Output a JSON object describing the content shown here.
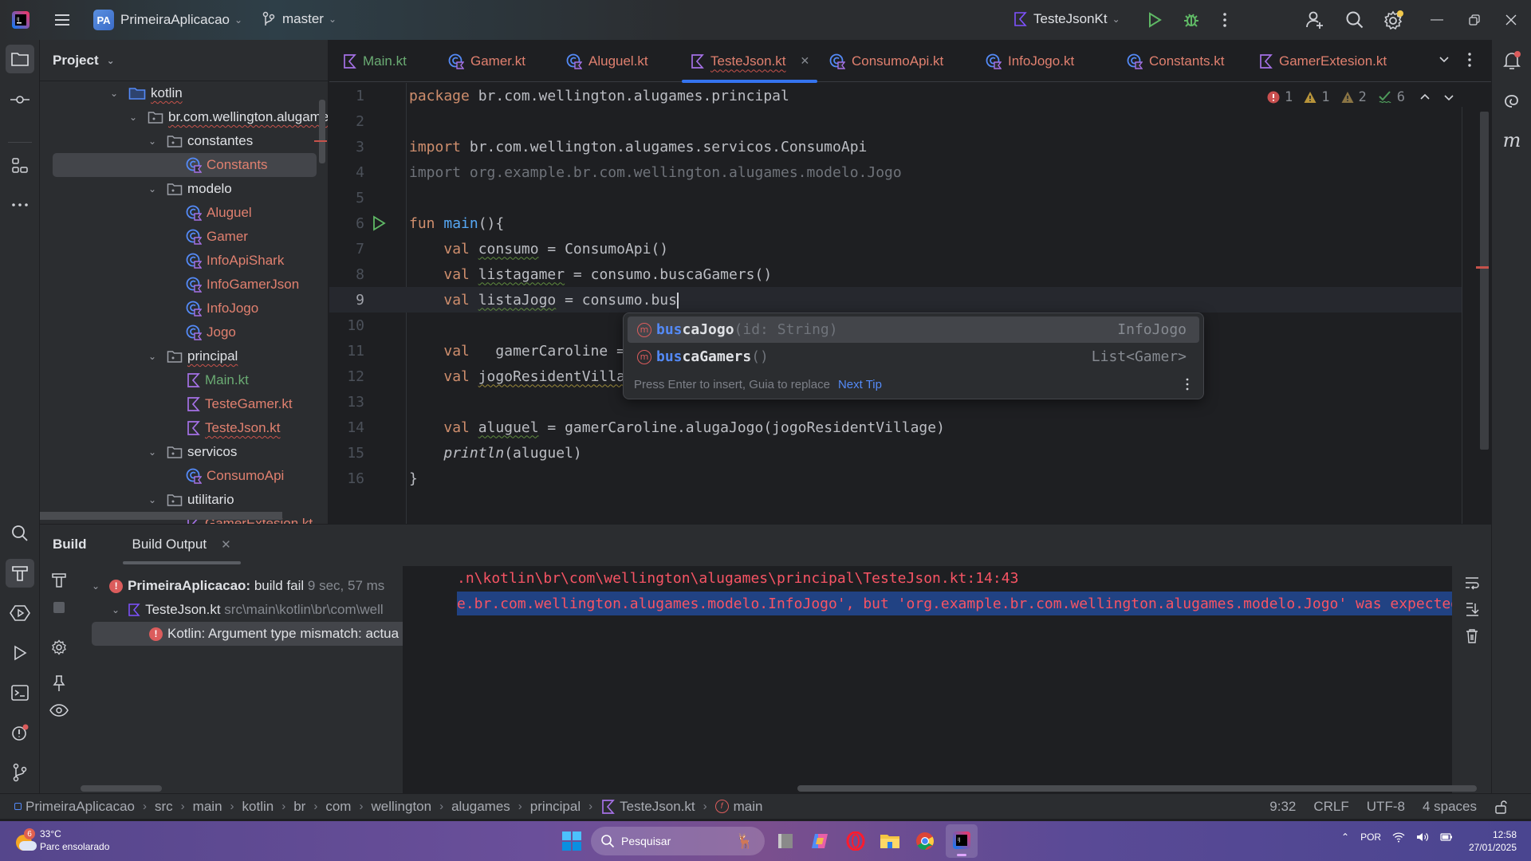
{
  "titlebar": {
    "project_badge": "PA",
    "project_name": "PrimeiraAplicacao",
    "branch": "master",
    "run_config": "TesteJsonKt",
    "icons": [
      "intellij-logo-icon",
      "main-menu-icon",
      "branch-icon",
      "kotlin-file-icon",
      "run-icon",
      "debug-icon",
      "more-vert-icon",
      "add-user-icon",
      "search-icon",
      "settings-icon",
      "minimize-icon",
      "restore-icon",
      "close-icon"
    ]
  },
  "left_strip": {
    "icons": [
      "project-folder-icon",
      "commit-icon",
      "structure-icon",
      "more-tools-icon",
      "find-icon",
      "build-hammer-icon",
      "services-icon",
      "run-icon",
      "terminal-icon",
      "problems-icon",
      "git-icon"
    ]
  },
  "right_strip": {
    "icons": [
      "notifications-icon",
      "ai-assistant-icon",
      "maven-icon"
    ]
  },
  "project_panel": {
    "title": "Project",
    "tree": [
      {
        "label": "kotlin",
        "type": "source-folder",
        "depth": 0,
        "expanded": true,
        "error": true
      },
      {
        "label": "br.com.wellington.alugames",
        "type": "package",
        "depth": 1,
        "expanded": true,
        "error": true
      },
      {
        "label": "constantes",
        "type": "package",
        "depth": 2,
        "expanded": true
      },
      {
        "label": "Constants",
        "type": "class",
        "depth": 3,
        "selected": true,
        "error": true
      },
      {
        "label": "modelo",
        "type": "package",
        "depth": 2,
        "expanded": true
      },
      {
        "label": "Aluguel",
        "type": "class",
        "depth": 3,
        "error": true
      },
      {
        "label": "Gamer",
        "type": "class",
        "depth": 3,
        "error": true
      },
      {
        "label": "InfoApiShark",
        "type": "class",
        "depth": 3,
        "error": true
      },
      {
        "label": "InfoGamerJson",
        "type": "class",
        "depth": 3,
        "error": true
      },
      {
        "label": "InfoJogo",
        "type": "class",
        "depth": 3,
        "error": true
      },
      {
        "label": "Jogo",
        "type": "class",
        "depth": 3,
        "error": true
      },
      {
        "label": "principal",
        "type": "package",
        "depth": 2,
        "expanded": true,
        "error": true
      },
      {
        "label": "Main.kt",
        "type": "kotlin-file",
        "depth": 3,
        "ok": true
      },
      {
        "label": "TesteGamer.kt",
        "type": "kotlin-file",
        "depth": 3,
        "error": true
      },
      {
        "label": "TesteJson.kt",
        "type": "kotlin-file",
        "depth": 3,
        "error": true
      },
      {
        "label": "servicos",
        "type": "package",
        "depth": 2,
        "expanded": true
      },
      {
        "label": "ConsumoApi",
        "type": "class",
        "depth": 3,
        "error": true
      },
      {
        "label": "utilitario",
        "type": "package",
        "depth": 2,
        "expanded": true
      },
      {
        "label": "GamerExtesion.kt",
        "type": "kotlin-file",
        "depth": 3,
        "error": true
      }
    ]
  },
  "editor_tabs": [
    {
      "label": "Main.kt",
      "type": "kotlin-file",
      "status": "ok"
    },
    {
      "label": "Gamer.kt",
      "type": "class",
      "status": "error"
    },
    {
      "label": "Aluguel.kt",
      "type": "class",
      "status": "error"
    },
    {
      "label": "TesteJson.kt",
      "type": "kotlin-file",
      "status": "error",
      "active": true,
      "closable": true
    },
    {
      "label": "ConsumoApi.kt",
      "type": "class",
      "status": "error"
    },
    {
      "label": "InfoJogo.kt",
      "type": "class",
      "status": "error"
    },
    {
      "label": "Constants.kt",
      "type": "class",
      "status": "error"
    },
    {
      "label": "GamerExtesion.kt",
      "type": "kotlin-file",
      "status": "error"
    }
  ],
  "inspections": {
    "errors": "1",
    "warnings": "1",
    "weak_warnings": "2",
    "typos": "6"
  },
  "code": {
    "current_line": 9,
    "lines": [
      {
        "n": "1",
        "text": "package br.com.wellington.alugames.principal"
      },
      {
        "n": "2",
        "text": ""
      },
      {
        "n": "3",
        "text": "import br.com.wellington.alugames.servicos.ConsumoApi"
      },
      {
        "n": "4",
        "text": "import org.example.br.com.wellington.alugames.modelo.Jogo"
      },
      {
        "n": "5",
        "text": ""
      },
      {
        "n": "6",
        "text": "fun main(){"
      },
      {
        "n": "7",
        "text": "    val consumo = ConsumoApi()"
      },
      {
        "n": "8",
        "text": "    val listagamer = consumo.buscaGamers()"
      },
      {
        "n": "9",
        "text": "    val listaJogo = consumo.bus"
      },
      {
        "n": "10",
        "text": ""
      },
      {
        "n": "11",
        "text": "    val  gamerCaroline = "
      },
      {
        "n": "12",
        "text": "    val jogoResidentVilla"
      },
      {
        "n": "13",
        "text": ""
      },
      {
        "n": "14",
        "text": "    val aluguel = gamerCaroline.alugaJogo(jogoResidentVillage)"
      },
      {
        "n": "15",
        "text": "    println(aluguel)"
      },
      {
        "n": "16",
        "text": "}"
      }
    ],
    "tokens": {
      "package_kw": "package",
      "package_name": " br.com.wellington.alugames.principal",
      "import_kw": "import",
      "import1": " br.com.wellington.alugames.servicos.ConsumoApi",
      "import2": " org.example.br.com.wellington.alugames.modelo.Jogo",
      "fun_kw": "fun",
      "main_name": "main",
      "main_rest": "(){",
      "val_kw": "val",
      "consumo_var": "consumo",
      "consumo_rest": " = ConsumoApi()",
      "listagamer_var": "listagamer",
      "listagamer_rest": " = consumo.buscaGamers()",
      "listajogo_var": "listaJogo",
      "listajogo_rest": " = consumo.bus",
      "caroline_rest": "  gamerCaroline = ",
      "resident_var": "jogoResidentVilla",
      "aluguel_var": "aluguel",
      "aluguel_rest": " = gamerCaroline.alugaJogo(jogoResidentVillage)",
      "println": "println",
      "println_rest": "(aluguel)",
      "close_brace": "}"
    }
  },
  "completion": {
    "typed_prefix": "bus",
    "items": [
      {
        "match": "bus",
        "rest": "caJogo",
        "params": "(id: String)",
        "return_type": "InfoJogo",
        "selected": true
      },
      {
        "match": "bus",
        "rest": "caGamers",
        "params": "()",
        "return_type": "List<Gamer>"
      }
    ],
    "footer_hint": "Press Enter to insert, Guia to replace",
    "footer_link": "Next Tip"
  },
  "build_panel": {
    "tab_build": "Build",
    "tab_output": "Build Output",
    "tree": [
      {
        "label": "PrimeiraAplicacao:",
        "status": "build fail",
        "time": "9 sec, 57 ms"
      },
      {
        "label": "TesteJson.kt",
        "path": "src\\main\\kotlin\\br\\com\\well"
      },
      {
        "label": "Kotlin: Argument type mismatch: actua"
      }
    ],
    "console": [
      ".n\\kotlin\\br\\com\\wellington\\alugames\\principal\\TesteJson.kt:14:43",
      "e.br.com.wellington.alugames.modelo.InfoJogo', but 'org.example.br.com.wellington.alugames.modelo.Jogo' was expected."
    ]
  },
  "statusbar": {
    "breadcrumbs": [
      "PrimeiraAplicacao",
      "src",
      "main",
      "kotlin",
      "br",
      "com",
      "wellington",
      "alugames",
      "principal",
      "TesteJson.kt",
      "main"
    ],
    "position": "9:32",
    "line_sep": "CRLF",
    "encoding": "UTF-8",
    "indent": "4 spaces"
  },
  "taskbar": {
    "weather_badge": "6",
    "temperature": "33°C",
    "weather_desc": "Parc ensolarado",
    "search_placeholder": "Pesquisar",
    "language": "POR",
    "time": "12:58",
    "date": "27/01/2025"
  }
}
